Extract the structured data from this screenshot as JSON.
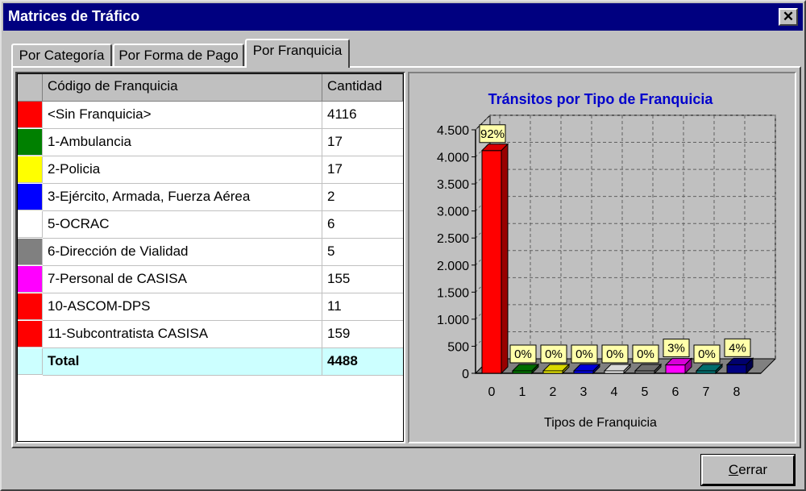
{
  "window": {
    "title": "Matrices de Tráfico"
  },
  "tabs": [
    {
      "label": "Por Categoría"
    },
    {
      "label": "Por Forma de Pago"
    },
    {
      "label": "Por Franquicia",
      "active": true
    }
  ],
  "table": {
    "columns": [
      "Código de Franquicia",
      "Cantidad"
    ],
    "rows": [
      {
        "color": "#ff0000",
        "label": "<Sin Franquicia>",
        "value": "4116"
      },
      {
        "color": "#008000",
        "label": "1-Ambulancia",
        "value": "17"
      },
      {
        "color": "#ffff00",
        "label": "2-Policia",
        "value": "17"
      },
      {
        "color": "#0000ff",
        "label": "3-Ejército, Armada, Fuerza Aérea",
        "value": "2"
      },
      {
        "color": "#ffffff",
        "label": "5-OCRAC",
        "value": "6"
      },
      {
        "color": "#808080",
        "label": "6-Dirección de Vialidad",
        "value": "5"
      },
      {
        "color": "#ff00ff",
        "label": "7-Personal de CASISA",
        "value": "155"
      },
      {
        "color": "#ff0000",
        "label": "10-ASCOM-DPS",
        "value": "11"
      },
      {
        "color": "#ff0000",
        "label": "11-Subcontratista CASISA",
        "value": "159"
      }
    ],
    "total": {
      "label": "Total",
      "value": "4488"
    }
  },
  "chart_data": {
    "type": "bar",
    "title": "Tránsitos por Tipo de Franquicia",
    "xlabel": "Tipos de Franquicia",
    "ylabel": "",
    "ylim": [
      0,
      4500
    ],
    "yticks": [
      "0",
      "500",
      "1.000",
      "1.500",
      "2.000",
      "2.500",
      "3.000",
      "3.500",
      "4.000",
      "4.500"
    ],
    "categories": [
      "0",
      "1",
      "2",
      "3",
      "4",
      "5",
      "6",
      "7",
      "8"
    ],
    "values": [
      4116,
      17,
      17,
      2,
      6,
      5,
      155,
      11,
      159
    ],
    "data_labels": [
      "92%",
      "0%",
      "0%",
      "0%",
      "0%",
      "0%",
      "3%",
      "0%",
      "4%"
    ],
    "colors": [
      "#ff0000",
      "#008000",
      "#ffff00",
      "#0000ff",
      "#ffffff",
      "#808080",
      "#ff00ff",
      "#008080",
      "#000080"
    ],
    "grid": true
  },
  "buttons": {
    "close": "Cerrar"
  }
}
